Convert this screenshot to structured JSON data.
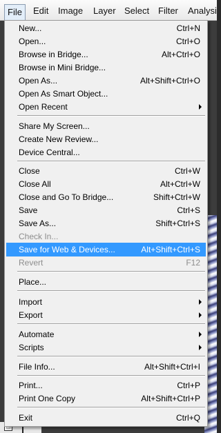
{
  "menubar": {
    "items": [
      "File",
      "Edit",
      "Image",
      "Layer",
      "Select",
      "Filter",
      "Analysis"
    ]
  },
  "file_menu": {
    "items": [
      {
        "label": "New...",
        "shortcut": "Ctrl+N"
      },
      {
        "label": "Open...",
        "shortcut": "Ctrl+O"
      },
      {
        "label": "Browse in Bridge...",
        "shortcut": "Alt+Ctrl+O"
      },
      {
        "label": "Browse in Mini Bridge...",
        "shortcut": ""
      },
      {
        "label": "Open As...",
        "shortcut": "Alt+Shift+Ctrl+O"
      },
      {
        "label": "Open As Smart Object...",
        "shortcut": ""
      },
      {
        "label": "Open Recent",
        "shortcut": ""
      },
      {
        "label": "Share My Screen...",
        "shortcut": ""
      },
      {
        "label": "Create New Review...",
        "shortcut": ""
      },
      {
        "label": "Device Central...",
        "shortcut": ""
      },
      {
        "label": "Close",
        "shortcut": "Ctrl+W"
      },
      {
        "label": "Close All",
        "shortcut": "Alt+Ctrl+W"
      },
      {
        "label": "Close and Go To Bridge...",
        "shortcut": "Shift+Ctrl+W"
      },
      {
        "label": "Save",
        "shortcut": "Ctrl+S"
      },
      {
        "label": "Save As...",
        "shortcut": "Shift+Ctrl+S"
      },
      {
        "label": "Check In...",
        "shortcut": ""
      },
      {
        "label": "Save for Web & Devices...",
        "shortcut": "Alt+Shift+Ctrl+S"
      },
      {
        "label": "Revert",
        "shortcut": "F12"
      },
      {
        "label": "Place...",
        "shortcut": ""
      },
      {
        "label": "Import",
        "shortcut": ""
      },
      {
        "label": "Export",
        "shortcut": ""
      },
      {
        "label": "Automate",
        "shortcut": ""
      },
      {
        "label": "Scripts",
        "shortcut": ""
      },
      {
        "label": "File Info...",
        "shortcut": "Alt+Shift+Ctrl+I"
      },
      {
        "label": "Print...",
        "shortcut": "Ctrl+P"
      },
      {
        "label": "Print One Copy",
        "shortcut": "Alt+Shift+Ctrl+P"
      },
      {
        "label": "Exit",
        "shortcut": "Ctrl+Q"
      }
    ]
  },
  "colors": {
    "highlight": "#3399ff",
    "disabled_text": "#8d8d8d",
    "menu_background": "#f0f0f0"
  }
}
